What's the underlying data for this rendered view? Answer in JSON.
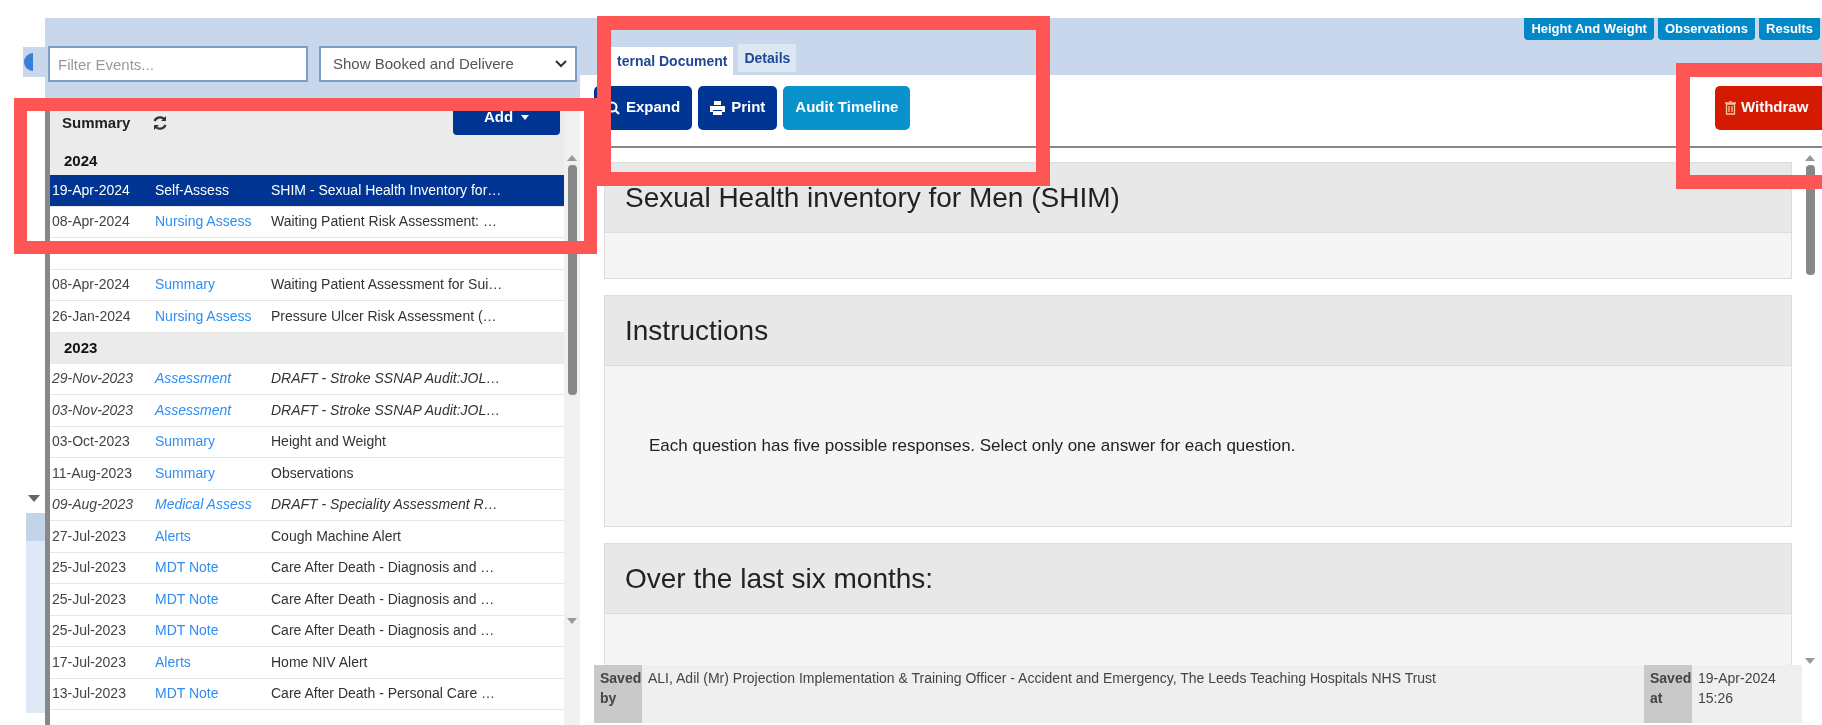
{
  "filter": {
    "placeholder": "Filter Events..."
  },
  "view_select": {
    "value": "Show Booked and Delivere"
  },
  "summary": {
    "title": "Summary",
    "add_button": "Add"
  },
  "event_groups": [
    {
      "year": "2024",
      "events": [
        {
          "date": "19-Apr-2024",
          "type": "Self-Assess",
          "description": "SHIM - Sexual Health Inventory for…",
          "selected": true,
          "draft": false
        },
        {
          "date": "08-Apr-2024",
          "type": "Nursing Assess",
          "description": "Waiting Patient Risk Assessment: …",
          "selected": false,
          "draft": false
        },
        {
          "date": "08-Apr-2024",
          "type": "Summary",
          "description": "Waiting Patient Assessment for Sui…",
          "selected": false,
          "draft": false
        },
        {
          "date": "26-Jan-2024",
          "type": "Nursing Assess",
          "description": "Pressure Ulcer Risk Assessment (…",
          "selected": false,
          "draft": false
        }
      ]
    },
    {
      "year": "2023",
      "events": [
        {
          "date": "29-Nov-2023",
          "type": "Assessment",
          "description": "DRAFT - Stroke SSNAP Audit:JOL…",
          "selected": false,
          "draft": true
        },
        {
          "date": "03-Nov-2023",
          "type": "Assessment",
          "description": "DRAFT - Stroke SSNAP Audit:JOL…",
          "selected": false,
          "draft": true
        },
        {
          "date": "03-Oct-2023",
          "type": "Summary",
          "description": "Height and Weight",
          "selected": false,
          "draft": false
        },
        {
          "date": "11-Aug-2023",
          "type": "Summary",
          "description": "Observations",
          "selected": false,
          "draft": false
        },
        {
          "date": "09-Aug-2023",
          "type": "Medical Assess",
          "description": "DRAFT - Speciality Assessment R…",
          "selected": false,
          "draft": true
        },
        {
          "date": "27-Jul-2023",
          "type": "Alerts",
          "description": "Cough Machine Alert",
          "selected": false,
          "draft": false
        },
        {
          "date": "25-Jul-2023",
          "type": "MDT Note",
          "description": "Care After Death - Diagnosis and …",
          "selected": false,
          "draft": false
        },
        {
          "date": "25-Jul-2023",
          "type": "MDT Note",
          "description": "Care After Death - Diagnosis and …",
          "selected": false,
          "draft": false
        },
        {
          "date": "25-Jul-2023",
          "type": "MDT Note",
          "description": "Care After Death - Diagnosis and …",
          "selected": false,
          "draft": false
        },
        {
          "date": "17-Jul-2023",
          "type": "Alerts",
          "description": "Home NIV Alert",
          "selected": false,
          "draft": false
        },
        {
          "date": "13-Jul-2023",
          "type": "MDT Note",
          "description": "Care After Death - Personal Care …",
          "selected": false,
          "draft": false
        }
      ]
    }
  ],
  "top_buttons": [
    "Height And Weight",
    "Observations",
    "Results"
  ],
  "tabs": [
    {
      "label": "ternal Document",
      "selected": true
    },
    {
      "label": "Details",
      "selected": false
    }
  ],
  "toolbar": [
    {
      "label": "Expand",
      "kind": "expand"
    },
    {
      "label": "Print",
      "kind": "print"
    },
    {
      "label": "Audit Timeline",
      "kind": "plain"
    }
  ],
  "withdraw_button": "Withdraw",
  "document": {
    "title": "Sexual Health inventory for Men (SHIM)",
    "sections": [
      {
        "heading": "Instructions",
        "body": "Each question has five possible responses. Select only one answer for each question."
      },
      {
        "heading": "Over the last six months:"
      }
    ]
  },
  "footer": {
    "saved_by_label": "Saved by",
    "saved_by": "ALI, Adil (Mr) Projection Implementation & Training Officer - Accident and Emergency, The Leeds Teaching Hospitals NHS Trust",
    "saved_at_label": "Saved at",
    "saved_at": "19-Apr-2024 15:26"
  }
}
